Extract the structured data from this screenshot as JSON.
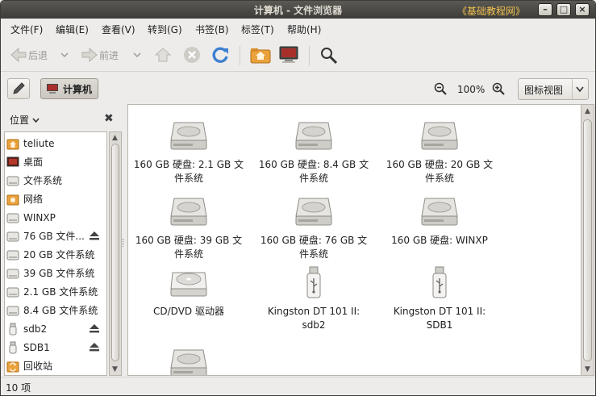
{
  "window": {
    "title": "计算机 - 文件浏览器",
    "watermark": "《基础教程网》",
    "buttons": {
      "minimize": "–",
      "maximize": "□",
      "close": "×"
    }
  },
  "menubar": {
    "items": [
      "文件(F)",
      "编辑(E)",
      "查看(V)",
      "转到(G)",
      "书签(B)",
      "标签(T)",
      "帮助(H)"
    ]
  },
  "toolbar": {
    "back_label": "后退",
    "forward_label": "前进",
    "icons": [
      "arrow-left-icon",
      "arrow-right-icon",
      "home-up-icon",
      "stop-icon",
      "reload-icon",
      "home-folder-icon",
      "computer-icon",
      "search-icon"
    ]
  },
  "locationbar": {
    "crumb": "计算机",
    "zoom": "100%",
    "view_mode": "图标视图"
  },
  "sidebar": {
    "header": "位置",
    "items": [
      {
        "label": "teliute",
        "icon": "home-icon",
        "eject": false
      },
      {
        "label": "桌面",
        "icon": "desktop-icon",
        "eject": false
      },
      {
        "label": "文件系统",
        "icon": "drive-icon",
        "eject": false
      },
      {
        "label": "网络",
        "icon": "network-icon",
        "eject": false
      },
      {
        "label": "WINXP",
        "icon": "drive-icon",
        "eject": false
      },
      {
        "label": "76 GB 文件...",
        "icon": "drive-icon",
        "eject": true
      },
      {
        "label": "20 GB 文件系统",
        "icon": "drive-icon",
        "eject": false
      },
      {
        "label": "39 GB 文件系统",
        "icon": "drive-icon",
        "eject": false
      },
      {
        "label": "2.1 GB 文件系统",
        "icon": "drive-icon",
        "eject": false
      },
      {
        "label": "8.4 GB 文件系统",
        "icon": "drive-icon",
        "eject": false
      },
      {
        "label": "sdb2",
        "icon": "usb-icon",
        "eject": true
      },
      {
        "label": "SDB1",
        "icon": "usb-icon",
        "eject": true
      },
      {
        "label": "回收站",
        "icon": "trash-icon",
        "eject": false
      }
    ]
  },
  "content": {
    "items": [
      {
        "line1": "160 GB 硬盘: 2.1 GB 文",
        "line2": "件系统",
        "icon": "harddisk-icon"
      },
      {
        "line1": "160 GB 硬盘: 8.4 GB 文",
        "line2": "件系统",
        "icon": "harddisk-icon"
      },
      {
        "line1": "160 GB 硬盘: 20 GB 文",
        "line2": "件系统",
        "icon": "harddisk-icon"
      },
      {
        "line1": "160 GB 硬盘: 39 GB 文",
        "line2": "件系统",
        "icon": "harddisk-icon"
      },
      {
        "line1": "160 GB 硬盘: 76 GB 文",
        "line2": "件系统",
        "icon": "harddisk-icon"
      },
      {
        "line1": "160 GB 硬盘: WINXP",
        "line2": "",
        "icon": "harddisk-icon"
      },
      {
        "line1": "CD/DVD 驱动器",
        "line2": "",
        "icon": "optical-drive-icon"
      },
      {
        "line1": "Kingston DT 101 II:",
        "line2": "sdb2",
        "icon": "usb-drive-icon"
      },
      {
        "line1": "Kingston DT 101 II:",
        "line2": "SDB1",
        "icon": "usb-drive-icon"
      },
      {
        "line1": "",
        "line2": "",
        "icon": "harddisk-icon"
      }
    ]
  },
  "statusbar": {
    "text": "10 项"
  }
}
